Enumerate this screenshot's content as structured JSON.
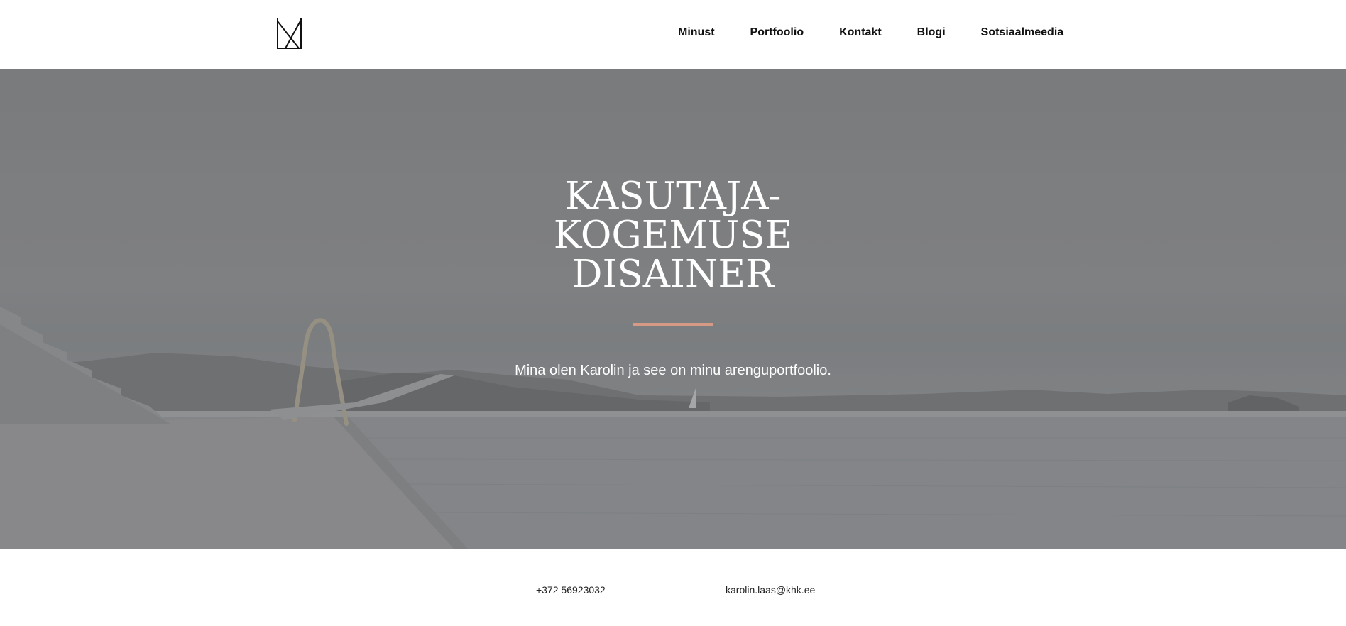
{
  "header": {
    "logo_icon": "lxa-monogram-logo",
    "nav": [
      {
        "label": "Minust"
      },
      {
        "label": "Portfoolio"
      },
      {
        "label": "Kontakt"
      },
      {
        "label": "Blogi"
      },
      {
        "label": "Sotsiaalmeedia"
      }
    ]
  },
  "hero": {
    "background": "harbor-pier-photo",
    "title_lines": [
      "KASUTAJA-",
      "KOGEMUSE",
      "DISAINER"
    ],
    "divider_color": "#d49a86",
    "subtitle": "Mina olen Karolin ja see on minu arenguportfoolio."
  },
  "footer": {
    "phone": "+372 56923032",
    "email": "karolin.laas@khk.ee"
  }
}
